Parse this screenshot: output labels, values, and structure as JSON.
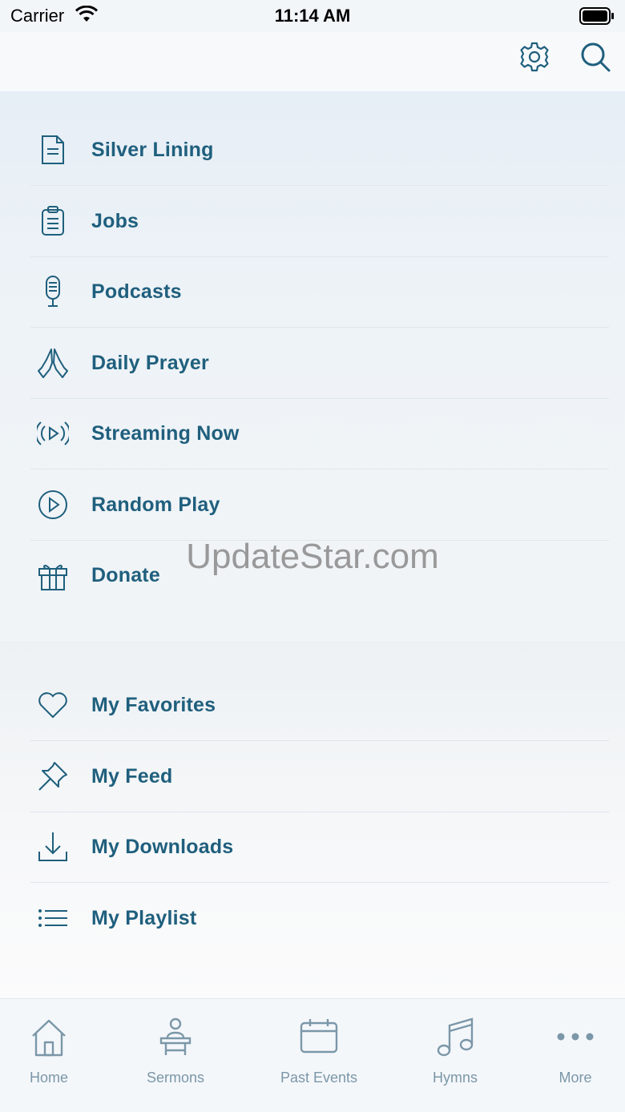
{
  "status_bar": {
    "carrier": "Carrier",
    "time": "11:14 AM"
  },
  "top_bar": {
    "settings_icon": "gear-icon",
    "search_icon": "search-icon"
  },
  "menu": {
    "primary": [
      {
        "label": "Silver Lining",
        "icon": "document-icon"
      },
      {
        "label": "Jobs",
        "icon": "clipboard-icon"
      },
      {
        "label": "Podcasts",
        "icon": "microphone-icon"
      },
      {
        "label": "Daily Prayer",
        "icon": "praying-hands-icon"
      },
      {
        "label": "Streaming Now",
        "icon": "broadcast-icon"
      },
      {
        "label": "Random Play",
        "icon": "play-circle-icon"
      },
      {
        "label": "Donate",
        "icon": "gift-icon"
      }
    ],
    "personal": [
      {
        "label": "My Favorites",
        "icon": "heart-icon"
      },
      {
        "label": "My Feed",
        "icon": "pin-icon"
      },
      {
        "label": "My Downloads",
        "icon": "download-icon"
      },
      {
        "label": "My Playlist",
        "icon": "list-icon"
      }
    ]
  },
  "watermark": "UpdateStar.com",
  "tab_bar": {
    "tabs": [
      {
        "label": "Home",
        "icon": "home-icon"
      },
      {
        "label": "Sermons",
        "icon": "preacher-icon"
      },
      {
        "label": "Past Events",
        "icon": "calendar-icon"
      },
      {
        "label": "Hymns",
        "icon": "music-note-icon"
      },
      {
        "label": "More",
        "icon": "more-icon"
      }
    ]
  },
  "colors": {
    "accent": "#1f5f7d",
    "tab_inactive": "#7b97a8",
    "divider": "#dfe6ec"
  }
}
